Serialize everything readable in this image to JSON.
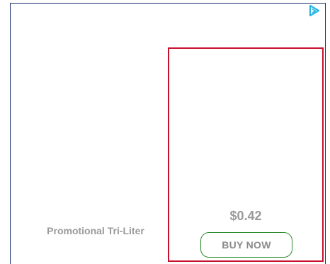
{
  "ad": {
    "adchoices_icon": "adchoices-icon",
    "product_name": "Promotional Tri-Liter",
    "price": "$0.42",
    "buy_label": "BUY NOW"
  },
  "colors": {
    "frame_border": "#1b2f6e",
    "panel_border": "#c8102e",
    "button_border": "#2e8b2e",
    "text_gray": "#9a9a9a",
    "adchoices": "#29b6e6"
  }
}
